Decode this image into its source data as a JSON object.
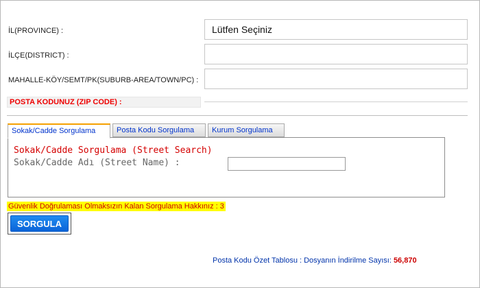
{
  "form": {
    "province_label": "İL(PROVINCE) :",
    "province_value": "Lütfen Seçiniz",
    "district_label": "İLÇE(DISTRICT) :",
    "district_value": "",
    "neighborhood_label": "MAHALLE-KÖY/SEMT/PK(SUBURB-AREA/TOWN/PC) :",
    "neighborhood_value": "",
    "zip_label": "POSTA KODUNUZ (ZIP CODE) :"
  },
  "tabs": [
    {
      "label": "Sokak/Cadde Sorgulama",
      "active": true
    },
    {
      "label": "Posta Kodu Sorgulama",
      "active": false
    },
    {
      "label": "Kurum Sorgulama",
      "active": false
    }
  ],
  "street_panel": {
    "title": "Sokak/Cadde Sorgulama (Street Search)",
    "field_label": "Sokak/Cadde Adı (Street Name) :",
    "field_value": ""
  },
  "warning": "Güvenlik Doğrulaması Olmaksızın Kalan Sorgulama Hakkınız : 3",
  "query_button": "SORGULA",
  "footer": {
    "link_text": "Posta Kodu Özet Tablosu",
    "downloads_label": " : Dosyanın İndirilme Sayısı: ",
    "downloads_count": "56,870"
  },
  "colors": {
    "tab_accent": "#f5a000",
    "button": "#1279e6",
    "error_red": "#ee0000",
    "link_blue": "#0033aa",
    "warning_bg": "#ffff00"
  }
}
